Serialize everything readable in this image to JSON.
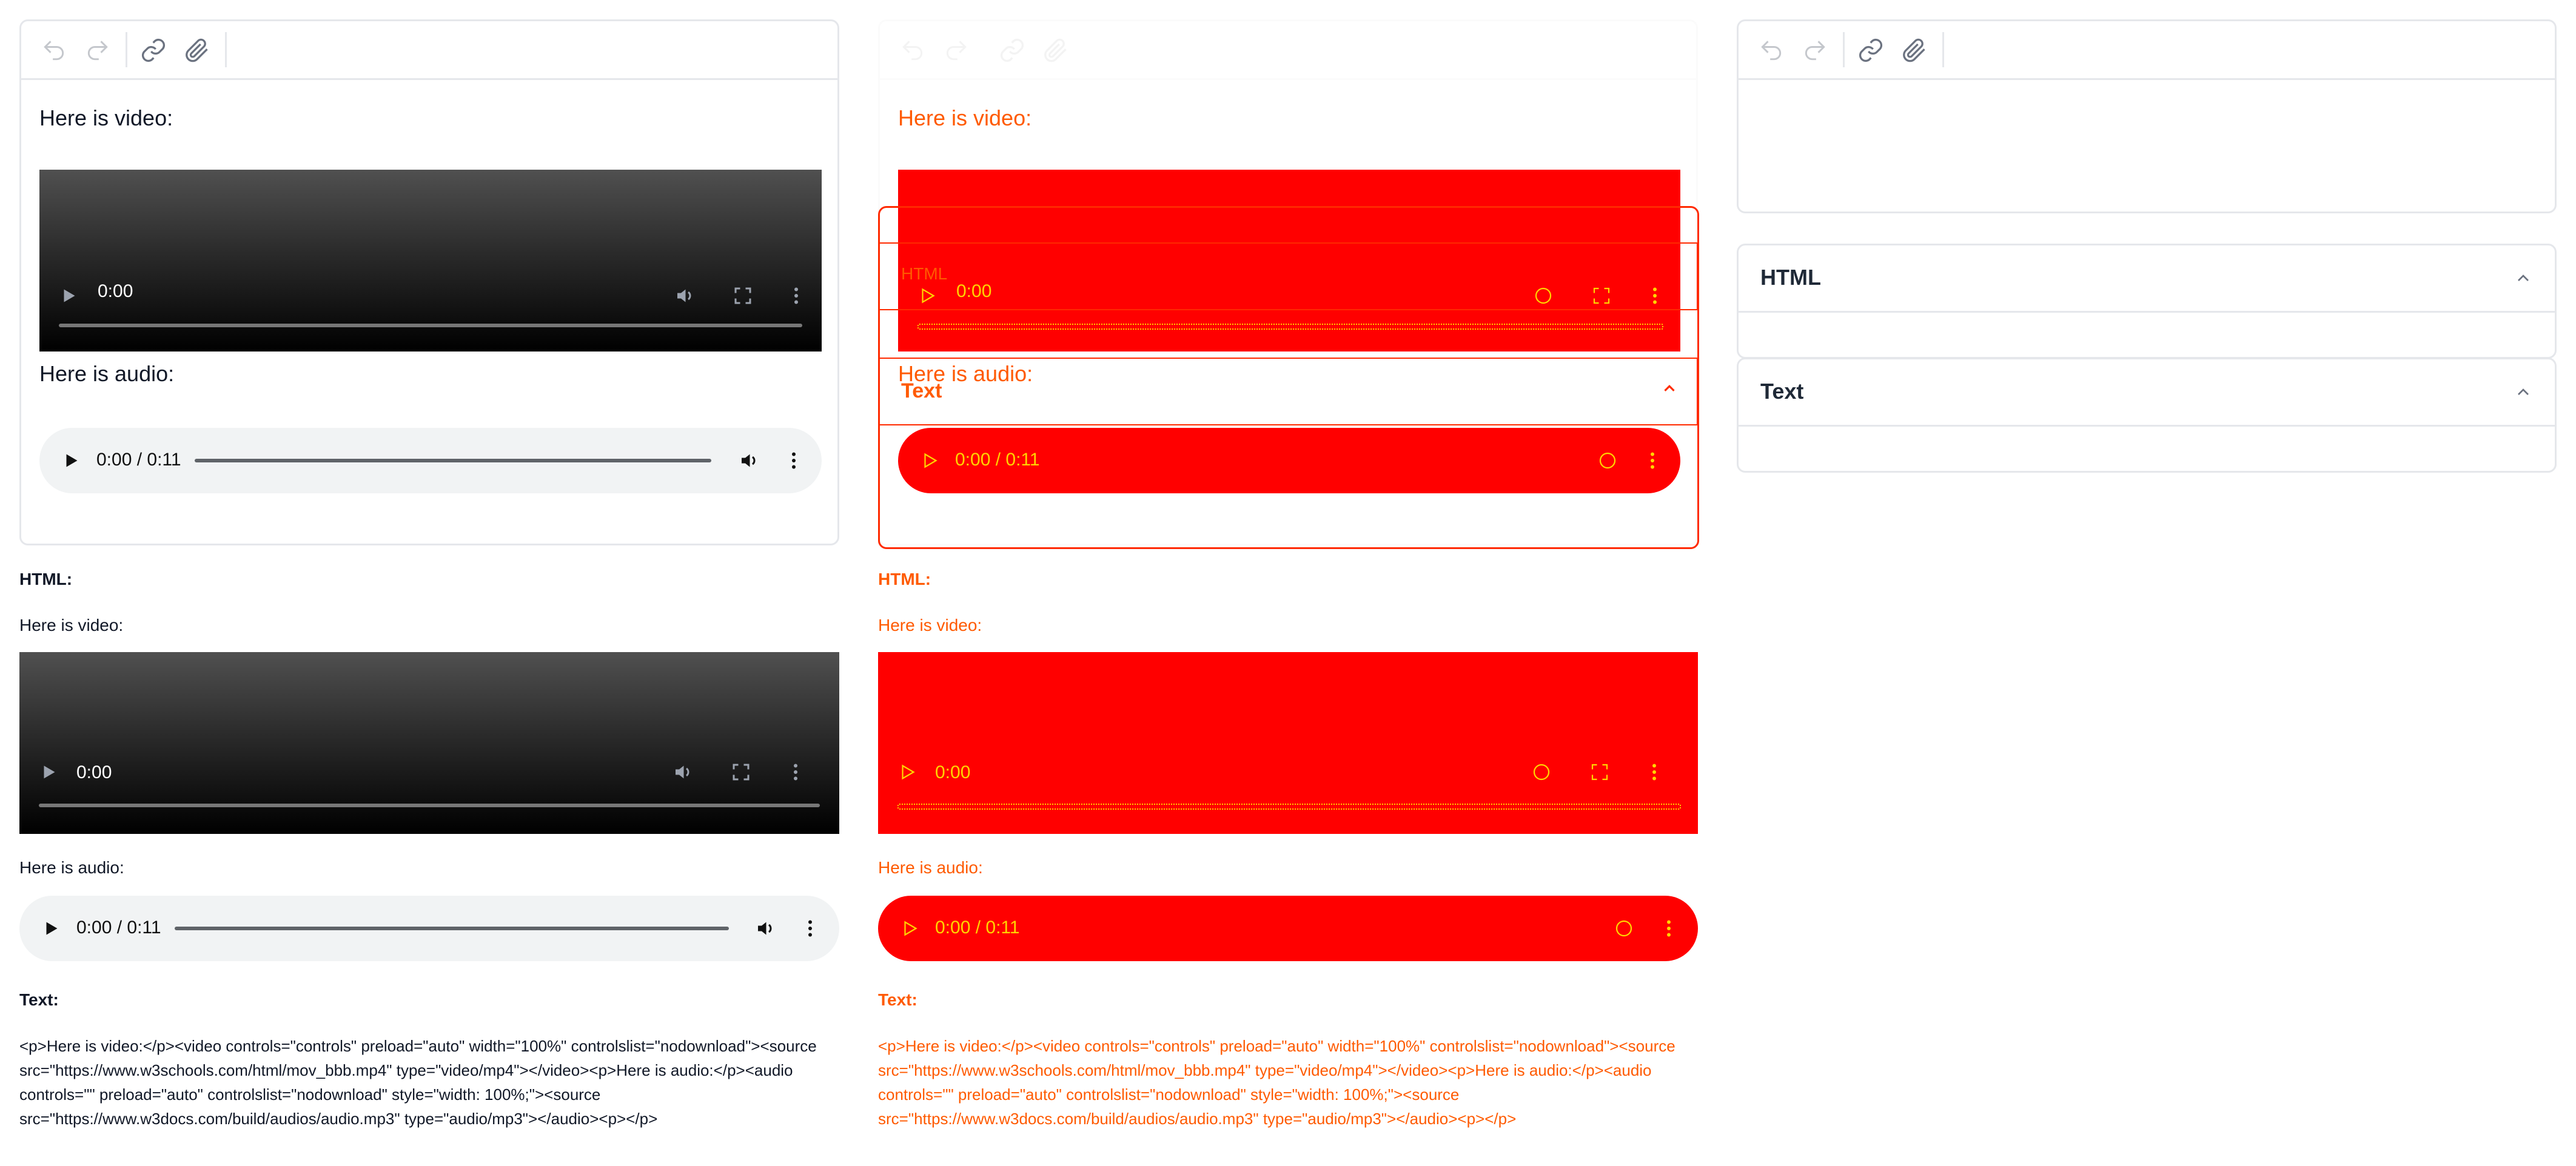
{
  "editor": {
    "para_video": "Here is video:",
    "para_audio": "Here is audio:"
  },
  "video": {
    "time": "0:00"
  },
  "audio": {
    "time": "0:00 / 0:11"
  },
  "output": {
    "html_label": "HTML:",
    "para_video": "Here is video:",
    "para_audio": "Here is audio:",
    "text_label": "Text:",
    "text_code": "<p>Here is video:</p><video controls=\"controls\" preload=\"auto\" width=\"100%\" controlslist=\"nodownload\"><source src=\"https://www.w3schools.com/html/mov_bbb.mp4\" type=\"video/mp4\"></video><p>Here is audio:</p><audio controls=\"\" preload=\"auto\" controlslist=\"nodownload\" style=\"width: 100%;\"><source src=\"https://www.w3docs.com/build/audios/audio.mp3\" type=\"audio/mp3\"></audio><p></p>"
  },
  "overlay": {
    "html_label": "HTML",
    "text_label": "Text"
  },
  "panels": {
    "html_title": "HTML",
    "text_title": "Text"
  },
  "colors": {
    "border": "#e5e7eb",
    "overlay_red": "#ff0000",
    "overlay_text": "#ff5a00"
  }
}
